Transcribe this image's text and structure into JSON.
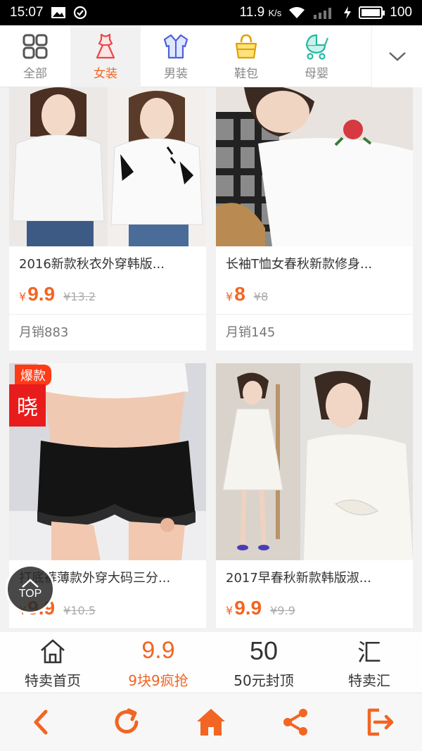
{
  "status": {
    "time": "15:07",
    "speed": "11.9",
    "speed_unit": "K/s",
    "battery": "100"
  },
  "categories": [
    {
      "label": "全部",
      "icon": "grid-icon"
    },
    {
      "label": "女装",
      "icon": "dress-icon",
      "active": true
    },
    {
      "label": "男装",
      "icon": "shirt-icon"
    },
    {
      "label": "鞋包",
      "icon": "bag-icon"
    },
    {
      "label": "母婴",
      "icon": "stroller-icon"
    }
  ],
  "products": [
    {
      "title": "2016新款秋衣外穿韩版...",
      "currency": "¥",
      "price": "9.9",
      "original": "¥13.2",
      "sales": "月销883"
    },
    {
      "title": "长袖T恤女春秋新款修身...",
      "currency": "¥",
      "price": "8",
      "original": "¥8",
      "sales": "月销145"
    },
    {
      "title": "打底裤薄款外穿大码三分...",
      "currency": "¥",
      "price": "9.9",
      "original": "¥10.5",
      "badge": "爆款",
      "overlay": "晓",
      "sales": ""
    },
    {
      "title": "2017早春秋新款韩版淑...",
      "currency": "¥",
      "price": "9.9",
      "original": "¥9.9",
      "sales": ""
    }
  ],
  "top_button": {
    "label": "TOP"
  },
  "bottom_nav": [
    {
      "label": "特卖首页",
      "icon": "home-outline-icon"
    },
    {
      "label": "9块9疯抢",
      "icon": "nine-nine-icon",
      "active": true,
      "icon_text": "9.9"
    },
    {
      "label": "50元封顶",
      "icon": "fifty-icon",
      "icon_text": "50"
    },
    {
      "label": "特卖汇",
      "icon": "hui-icon",
      "icon_text": "汇"
    }
  ],
  "colors": {
    "accent": "#f26522",
    "badge": "#ff3b16"
  }
}
